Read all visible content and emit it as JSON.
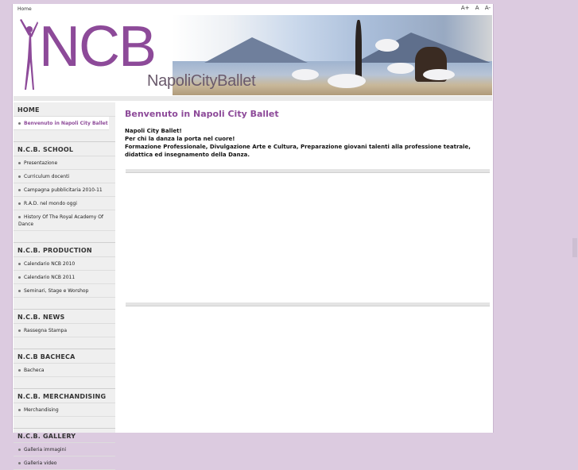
{
  "topbar": {
    "home": "Home",
    "font_sizes": [
      "A+",
      "A",
      "A-"
    ]
  },
  "logo": {
    "main": "NCB",
    "sub": "NapoliCityBallet"
  },
  "sidebar": {
    "home": {
      "title": "HOME",
      "items": [
        "Benvenuto in Napoli City Ballet"
      ]
    },
    "school": {
      "title": "N.C.B. SCHOOL",
      "items": [
        "Presentazione",
        "Curriculum docenti",
        "Campagna pubblicitaria 2010-11",
        "R.A.D. nel mondo oggi",
        "History Of The Royal Academy Of Dance"
      ]
    },
    "production": {
      "title": "N.C.B. PRODUCTION",
      "items": [
        "Calendario NCB 2010",
        "Calendario NCB 2011",
        "Seminari, Stage e Worshop"
      ]
    },
    "news": {
      "title": "N.C.B. NEWS",
      "items": [
        "Rassegna Stampa"
      ]
    },
    "bacheca": {
      "title": "N.C.B BACHECA",
      "items": [
        "Bacheca"
      ]
    },
    "merch": {
      "title": "N.C.B. MERCHANDISING",
      "items": [
        "Merchandising"
      ]
    },
    "gallery": {
      "title": "N.C.B. GALLERY",
      "items": [
        "Galleria immagini",
        "Galleria video"
      ]
    }
  },
  "main": {
    "title": "Benvenuto in Napoli City Ballet",
    "intro_lines": [
      "Napoli City Ballet!",
      "Per chi la danza la porta nel cuore!",
      "Formazione Professionale, Divulgazione Arte e Cultura, Preparazione giovani talenti alla professione teatrale, didattica ed insegnamento della Danza."
    ]
  },
  "colors": {
    "accent": "#8d4a99",
    "background": "#dccbe0"
  }
}
